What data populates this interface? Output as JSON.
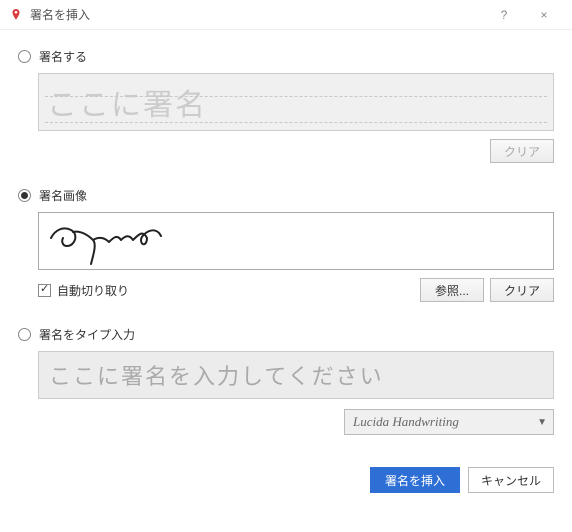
{
  "window": {
    "title": "署名を挿入",
    "help_label": "?",
    "close_label": "×"
  },
  "options": {
    "draw": {
      "label": "署名する",
      "placeholder": "ここに署名",
      "clear": "クリア",
      "selected": false
    },
    "image": {
      "label": "署名画像",
      "auto_trim": "自動切り取り",
      "auto_trim_checked": true,
      "browse": "参照...",
      "clear": "クリア",
      "selected": true
    },
    "type": {
      "label": "署名をタイプ入力",
      "placeholder": "ここに署名を入力してください",
      "font": "Lucida Handwriting",
      "selected": false
    }
  },
  "footer": {
    "insert": "署名を挿入",
    "cancel": "キャンセル"
  }
}
